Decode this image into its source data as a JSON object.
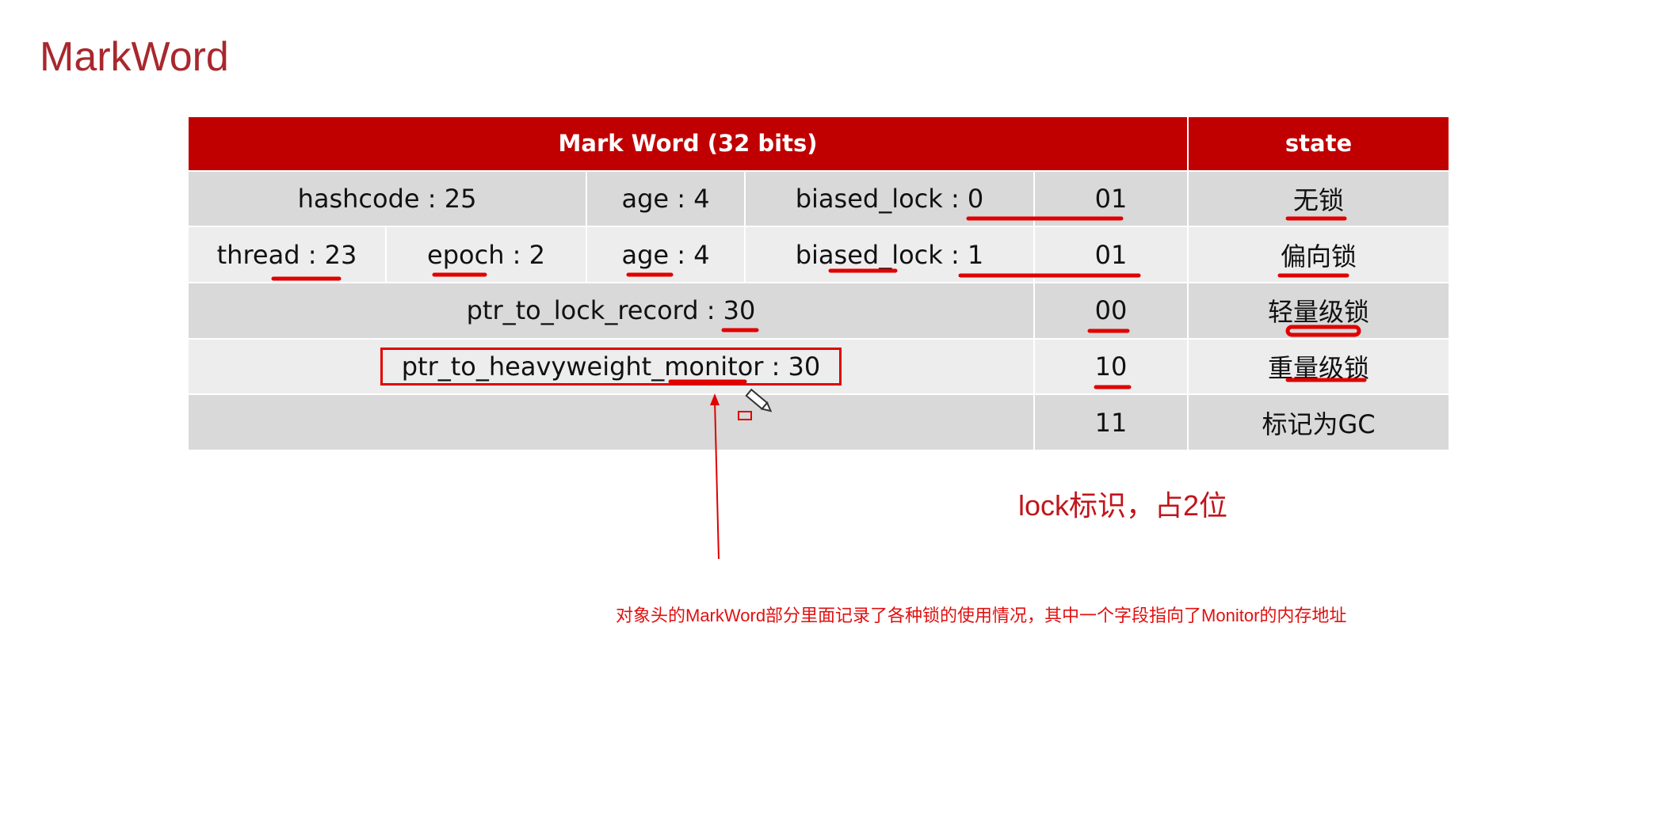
{
  "title": "MarkWord",
  "table": {
    "header": {
      "markword": "Mark Word (32 bits)",
      "state": "state"
    },
    "rows": [
      {
        "cells": [
          "hashcode : 25",
          "age : 4",
          "biased_lock : 0",
          "01"
        ],
        "state": "无锁"
      },
      {
        "cells": [
          "thread : 23",
          "epoch : 2",
          "age : 4",
          "biased_lock : 1",
          "01"
        ],
        "state": "偏向锁"
      },
      {
        "cells": [
          "ptr_to_lock_record : 30",
          "00"
        ],
        "state": "轻量级锁"
      },
      {
        "cells": [
          "ptr_to_heavyweight_monitor : 30",
          "10"
        ],
        "state": "重量级锁"
      },
      {
        "cells": [
          "",
          "11"
        ],
        "state": "标记为GC"
      }
    ]
  },
  "lock_note": "lock标识，占2位",
  "caption": "对象头的MarkWord部分里面记录了各种锁的使用情况，其中一个字段指向了Monitor的内存地址",
  "colors": {
    "header": "#c00000",
    "annotation": "#e00000",
    "title": "#a8282d"
  },
  "icons": [
    "pencil-cursor-icon"
  ]
}
